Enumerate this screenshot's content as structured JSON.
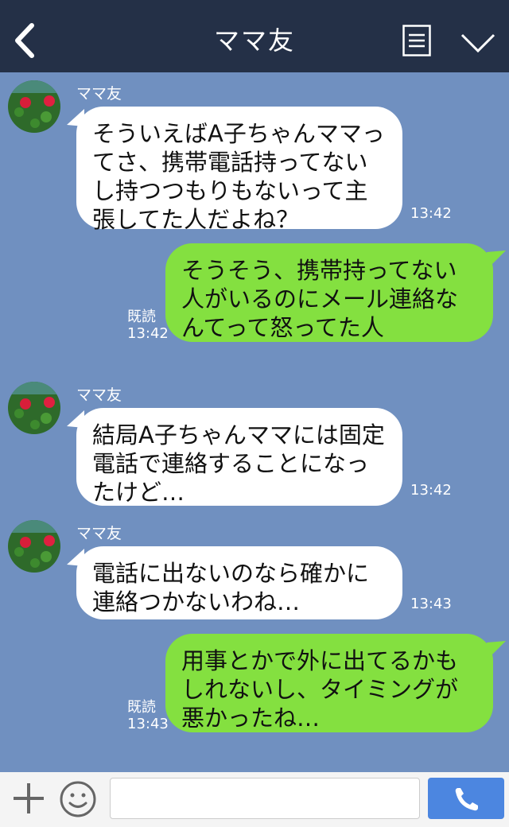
{
  "header": {
    "title": "ママ友"
  },
  "messages": [
    {
      "sender": "ママ友",
      "text": "そういえばA子ちゃんママってさ、携帯電話持ってないし持つつもりもないって主張してた人だよね？",
      "time": "13:42"
    },
    {
      "read": "既読",
      "text": "そうそう、携帯持ってない人がいるのにメール連絡なんてって怒ってた人",
      "time": "13:42"
    },
    {
      "sender": "ママ友",
      "text": "結局A子ちゃんママには固定電話で連絡することになったけど…",
      "time": "13:42"
    },
    {
      "sender": "ママ友",
      "text": "電話に出ないのなら確かに連絡つかないわね…",
      "time": "13:43"
    },
    {
      "read": "既読",
      "text": "用事とかで外に出てるかもしれないし、タイミングが悪かったね…",
      "time": "13:43"
    }
  ],
  "colors": {
    "header": "#243047",
    "chat_bg": "#7090c0",
    "incoming": "#ffffff",
    "outgoing": "#84e040",
    "call_button": "#4c86e0"
  },
  "icons": [
    "back-icon",
    "menu-icon",
    "chevron-down-icon",
    "plus-icon",
    "emoji-icon",
    "phone-icon"
  ]
}
